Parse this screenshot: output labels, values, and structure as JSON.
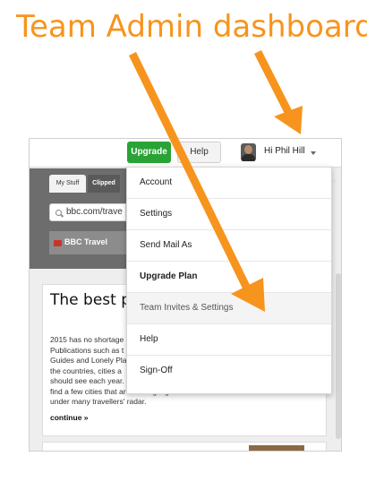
{
  "annotation": {
    "title": "Team Admin dashboard",
    "accent_color": "#f7941d"
  },
  "topbar": {
    "upgrade_label": "Upgrade",
    "help_label": "Help",
    "user_greeting": "Hi Phil Hill",
    "upgrade_color": "#2aa336"
  },
  "tabs": {
    "my_stuff": "My Stuff",
    "clipped": "Clipped",
    "right_tab_fragment": "n"
  },
  "search": {
    "url": "bbc.com/trave"
  },
  "source": {
    "name": "BBC Travel"
  },
  "article": {
    "title": "The best pla year",
    "body_lines": [
      "2015 has no shortage",
      "Publications such as t",
      "Guides and Lonely Pla",
      "the countries, cities a",
      "should see each year.",
      "find a few cities that are making big strides but still",
      "under many travellers' radar."
    ],
    "continue_label": "continue »"
  },
  "menu": {
    "items": [
      {
        "label": "Account"
      },
      {
        "label": "Settings"
      },
      {
        "label": "Send Mail As"
      },
      {
        "label": "Upgrade Plan"
      },
      {
        "label": "Team Invites & Settings"
      },
      {
        "label": "Help"
      },
      {
        "label": "Sign-Off"
      }
    ]
  }
}
